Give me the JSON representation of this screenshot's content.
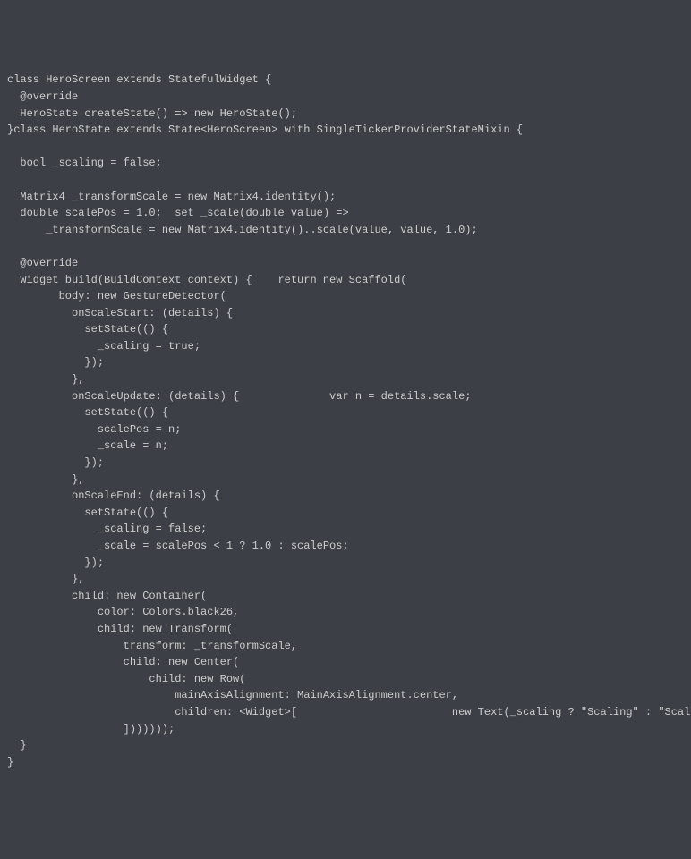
{
  "code": {
    "lines": [
      "class HeroScreen extends StatefulWidget {",
      "  @override",
      "  HeroState createState() => new HeroState();",
      "}class HeroState extends State<HeroScreen> with SingleTickerProviderStateMixin {",
      "",
      "  bool _scaling = false;",
      "",
      "  Matrix4 _transformScale = new Matrix4.identity();",
      "  double scalePos = 1.0;  set _scale(double value) =>",
      "      _transformScale = new Matrix4.identity()..scale(value, value, 1.0);",
      "",
      "  @override",
      "  Widget build(BuildContext context) {    return new Scaffold(",
      "        body: new GestureDetector(",
      "          onScaleStart: (details) {",
      "            setState(() {",
      "              _scaling = true;",
      "            });",
      "          },",
      "          onScaleUpdate: (details) {              var n = details.scale;",
      "            setState(() {",
      "              scalePos = n;",
      "              _scale = n;",
      "            });",
      "          },",
      "          onScaleEnd: (details) {",
      "            setState(() {",
      "              _scaling = false;",
      "              _scale = scalePos < 1 ? 1.0 : scalePos;",
      "            });",
      "          },",
      "          child: new Container(",
      "              color: Colors.black26,",
      "              child: new Transform(",
      "                  transform: _transformScale,",
      "                  child: new Center(",
      "                      child: new Row(",
      "                          mainAxisAlignment: MainAxisAlignment.center,",
      "                          children: <Widget>[                        new Text(_scaling ? \"Scaling\" : \"Scale me up\"",
      "                  ]))))));",
      "  }",
      "}"
    ]
  }
}
